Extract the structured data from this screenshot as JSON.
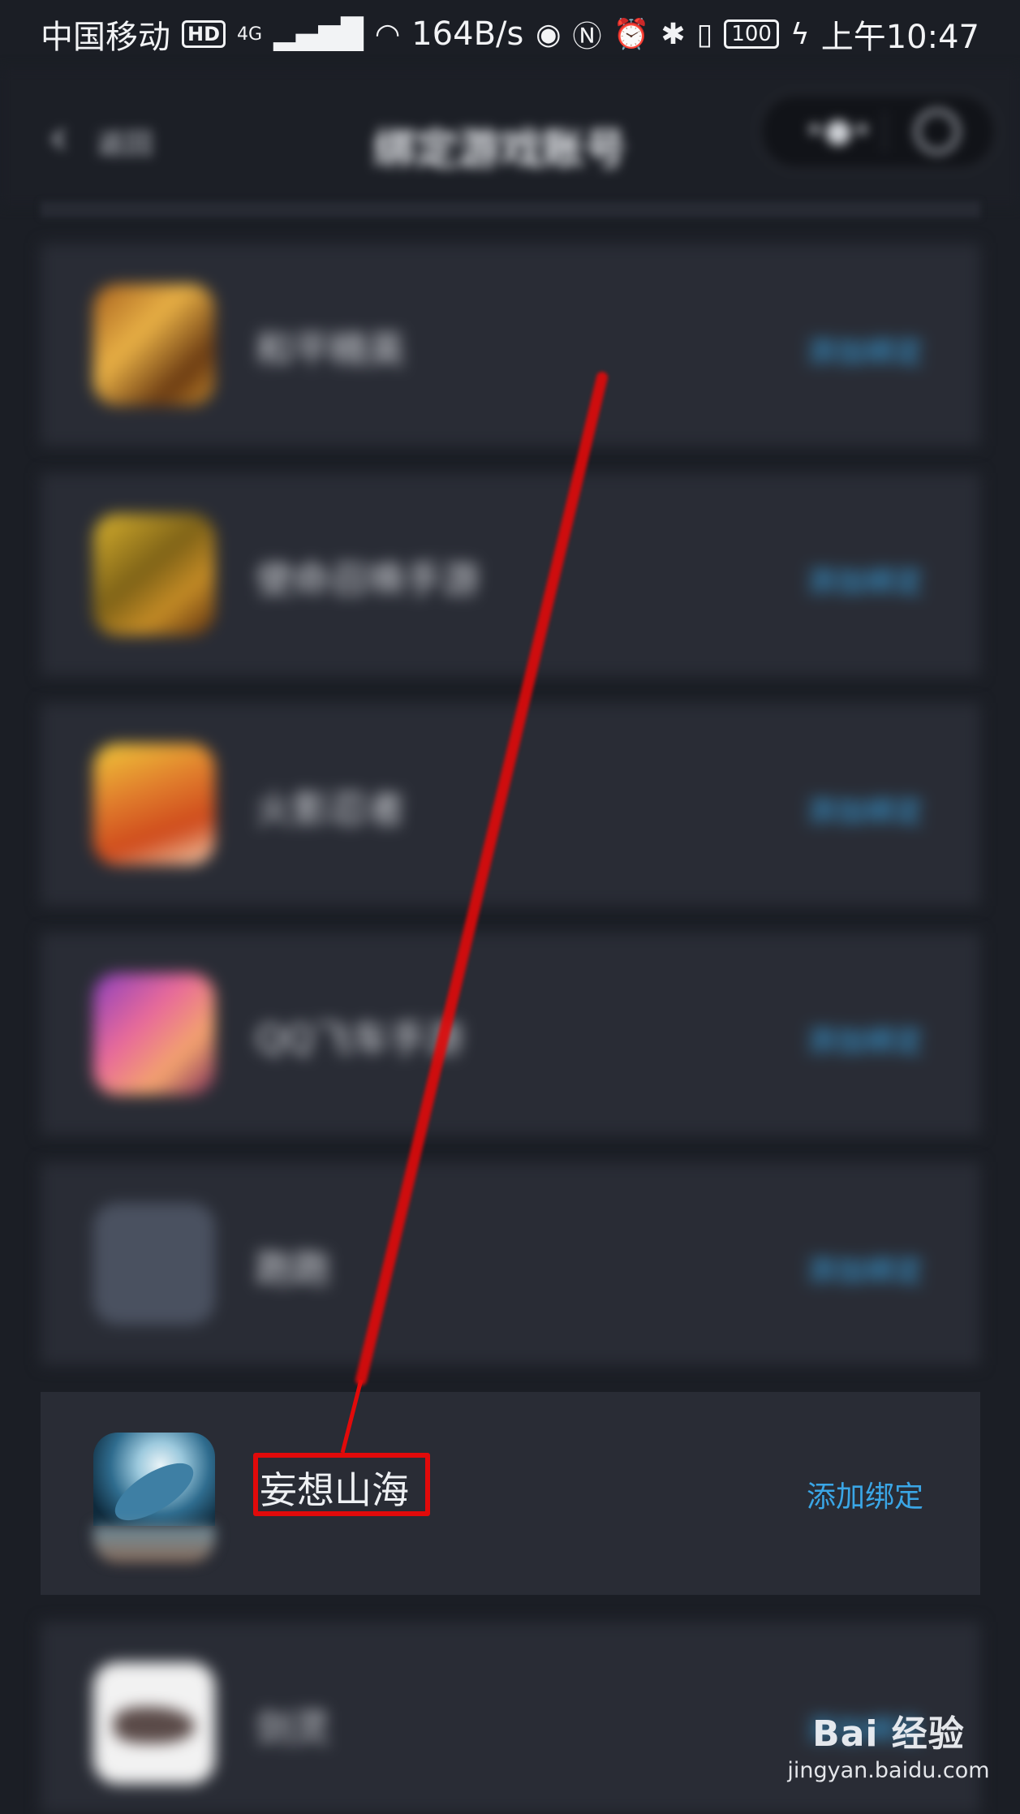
{
  "status_bar": {
    "carrier": "中国移动",
    "hd_badge": "HD",
    "network": "4G",
    "speed": "164B/s",
    "battery": "100",
    "time": "上午10:47",
    "icons": [
      "eye-icon",
      "nfc-icon",
      "alarm-icon",
      "bluetooth-icon",
      "vibrate-icon",
      "charging-icon",
      "wifi-icon",
      "signal-icon"
    ]
  },
  "nav": {
    "back_label": "返回",
    "title": "绑定游戏账号",
    "capsule_icons": [
      "more-dots-icon",
      "close-circle-icon"
    ]
  },
  "games": [
    {
      "name": "和平精英",
      "action": "添加绑定",
      "icon": "pubg-game-icon"
    },
    {
      "name": "使命召唤手游",
      "action": "添加绑定",
      "icon": "cod-game-icon"
    },
    {
      "name": "火影忍者",
      "action": "添加绑定",
      "icon": "naruto-game-icon"
    },
    {
      "name": "QQ飞车手游",
      "action": "添加绑定",
      "icon": "qq-speed-game-icon"
    },
    {
      "name": "跑跑",
      "action": "添加绑定",
      "icon": "generic-game-icon"
    },
    {
      "name": "妄想山海",
      "action": "添加绑定",
      "icon": "whale-game-icon"
    },
    {
      "name": "剑灵",
      "action": "添加绑定",
      "icon": "white-game-icon"
    }
  ],
  "annotation": {
    "color": "#e10a0a",
    "highlighted_item": "妄想山海"
  },
  "watermark": {
    "logo_text": "Bai  经验",
    "url": "jingyan.baidu.com"
  },
  "colors": {
    "background": "#1b1e25",
    "card": "#292c35",
    "accent": "#3aa6e6"
  }
}
